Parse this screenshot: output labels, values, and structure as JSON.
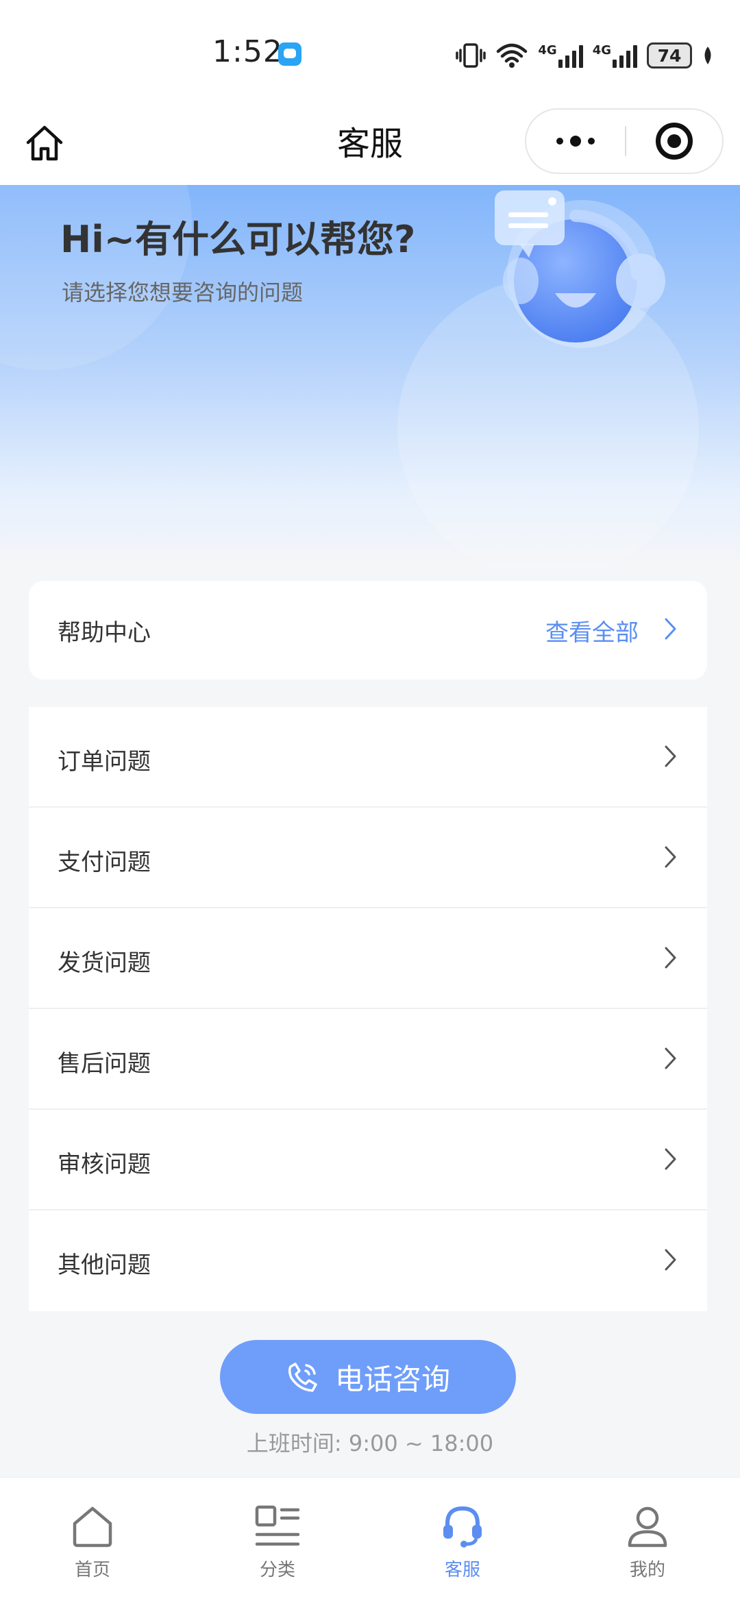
{
  "status_bar": {
    "time": "1:52",
    "network_1": "4G",
    "network_2": "4G",
    "battery": "74"
  },
  "nav": {
    "title": "客服"
  },
  "hero": {
    "title": "Hi~有什么可以帮您?",
    "subtitle": "请选择您想要咨询的问题"
  },
  "help_center": {
    "title": "帮助中心",
    "view_all": "查看全部"
  },
  "questions": [
    {
      "label": "订单问题"
    },
    {
      "label": "支付问题"
    },
    {
      "label": "发货问题"
    },
    {
      "label": "售后问题"
    },
    {
      "label": "审核问题"
    },
    {
      "label": "其他问题"
    }
  ],
  "phone": {
    "label": "电话咨询",
    "hours": "上班时间:  9:00 ~ 18:00"
  },
  "tabs": [
    {
      "label": "首页",
      "icon": "home-icon"
    },
    {
      "label": "分类",
      "icon": "category-icon"
    },
    {
      "label": "客服",
      "icon": "headset-icon",
      "active": true
    },
    {
      "label": "我的",
      "icon": "profile-icon"
    }
  ],
  "colors": {
    "accent": "#5b8ef0",
    "button": "#6f9efa",
    "hero_top": "#82b5fb"
  }
}
